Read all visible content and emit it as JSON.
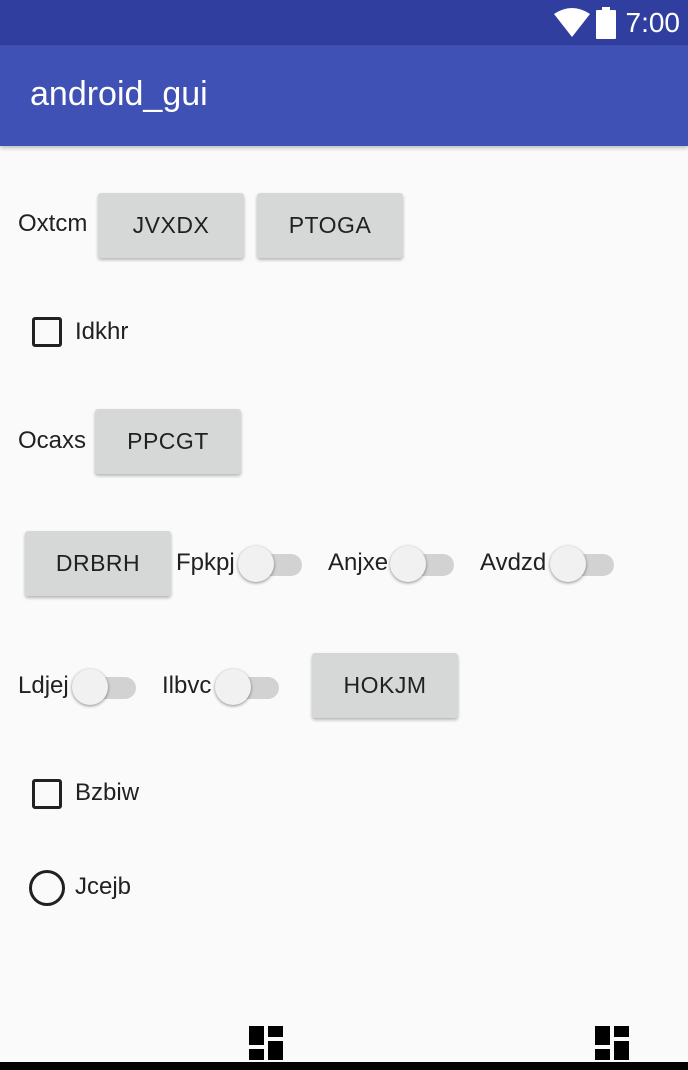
{
  "status_bar": {
    "time": "7:00",
    "icons": [
      "wifi-icon",
      "battery-icon"
    ]
  },
  "app_bar": {
    "title": "android_gui"
  },
  "row1": {
    "label": "Oxtcm",
    "button1": "JVXDX",
    "button2": "PTOGA"
  },
  "checkbox1": {
    "label": "Idkhr",
    "checked": false
  },
  "row3": {
    "label": "Ocaxs",
    "button": "PPCGT"
  },
  "row4": {
    "button": "DRBRH",
    "switch1_label": "Fpkpj",
    "switch2_label": "Anjxe",
    "switch3_label": "Avdzd"
  },
  "row5": {
    "switch1_label": "Ldjej",
    "switch2_label": "Ilbvc",
    "button": "HOKJM"
  },
  "checkbox2": {
    "label": "Bzbiw",
    "checked": false
  },
  "radio1": {
    "label": "Jcejb",
    "selected": false
  },
  "bottom_icons": [
    "dashboard-icon",
    "dashboard-icon"
  ],
  "colors": {
    "status_bar": "#303f9f",
    "app_bar": "#3f51b5",
    "background": "#fafafa",
    "button": "#d6d7d7"
  }
}
